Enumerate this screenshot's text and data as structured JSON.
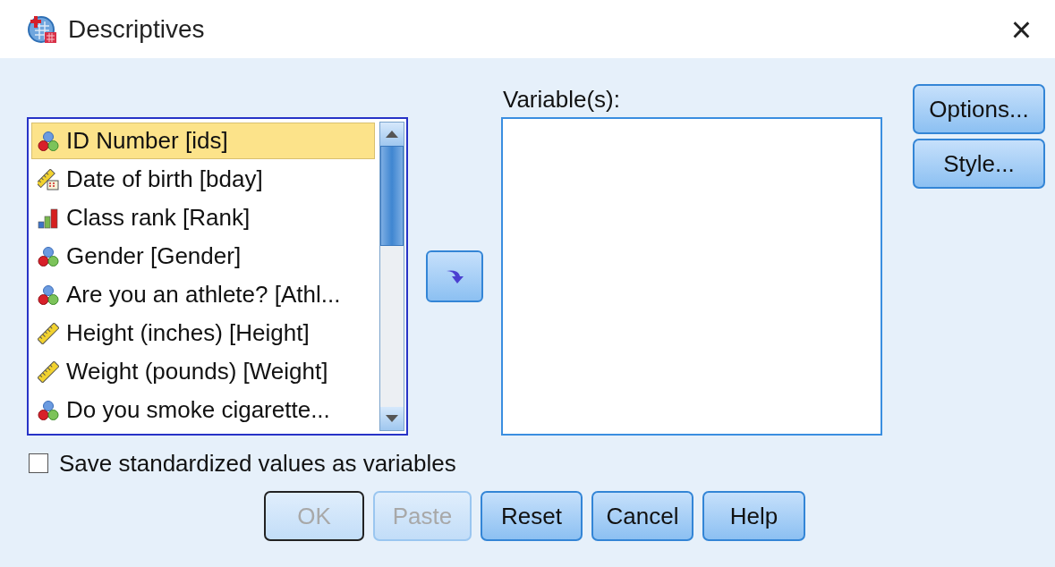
{
  "window": {
    "title": "Descriptives",
    "close": "×"
  },
  "source_list": {
    "items": [
      {
        "label": "ID Number [ids]",
        "kind": "nominal",
        "selected": true
      },
      {
        "label": "Date of birth [bday]",
        "kind": "date",
        "selected": false
      },
      {
        "label": "Class rank [Rank]",
        "kind": "ordinal",
        "selected": false
      },
      {
        "label": "Gender [Gender]",
        "kind": "nominal",
        "selected": false
      },
      {
        "label": "Are you an athlete? [Athl...",
        "kind": "nominal",
        "selected": false
      },
      {
        "label": "Height (inches) [Height]",
        "kind": "scale",
        "selected": false
      },
      {
        "label": "Weight (pounds) [Weight]",
        "kind": "scale",
        "selected": false
      },
      {
        "label": "Do you smoke cigarette...",
        "kind": "nominal",
        "selected": false
      }
    ]
  },
  "target_list": {
    "label": "Variable(s):"
  },
  "side_buttons": [
    {
      "label": "Options...",
      "disabled": false
    },
    {
      "label": "Style...",
      "disabled": false
    }
  ],
  "save_standardized": {
    "label": "Save standardized values as variables",
    "checked": false
  },
  "buttons": [
    {
      "label": "OK",
      "disabled": true,
      "default": true
    },
    {
      "label": "Paste",
      "disabled": true,
      "default": false
    },
    {
      "label": "Reset",
      "disabled": false,
      "default": false
    },
    {
      "label": "Cancel",
      "disabled": false,
      "default": false
    },
    {
      "label": "Help",
      "disabled": false,
      "default": false
    }
  ]
}
